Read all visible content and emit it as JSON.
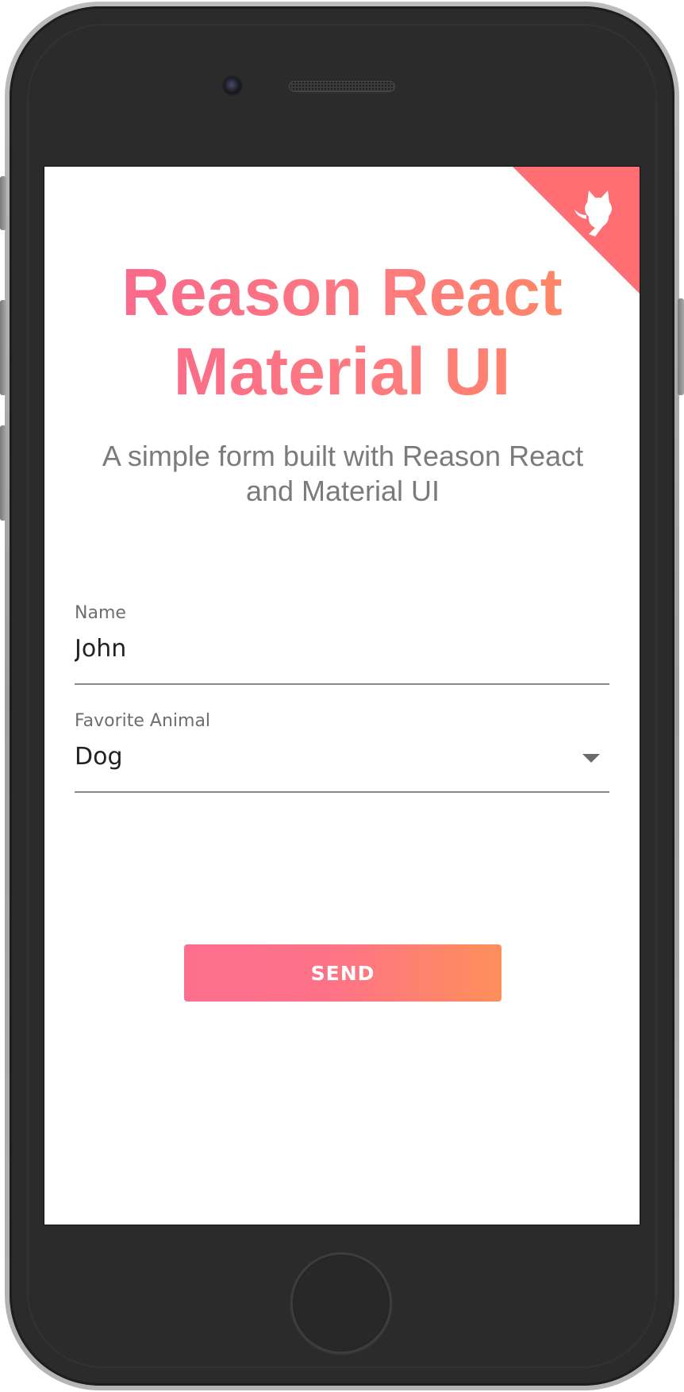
{
  "app": {
    "title_line1": "Reason React",
    "title_line2": "Material UI",
    "subtitle": "A simple form built with Reason React and Material UI",
    "corner_link_icon": "github-octocat-icon",
    "corner_color": "#fe6e73"
  },
  "form": {
    "name": {
      "label": "Name",
      "value": "John"
    },
    "favorite_animal": {
      "label": "Favorite Animal",
      "selected": "Dog"
    },
    "submit_label": "SEND"
  },
  "colors": {
    "accent_start": "#f9648e",
    "accent_end": "#fe8a5c",
    "text_muted": "#7b7b7b"
  }
}
